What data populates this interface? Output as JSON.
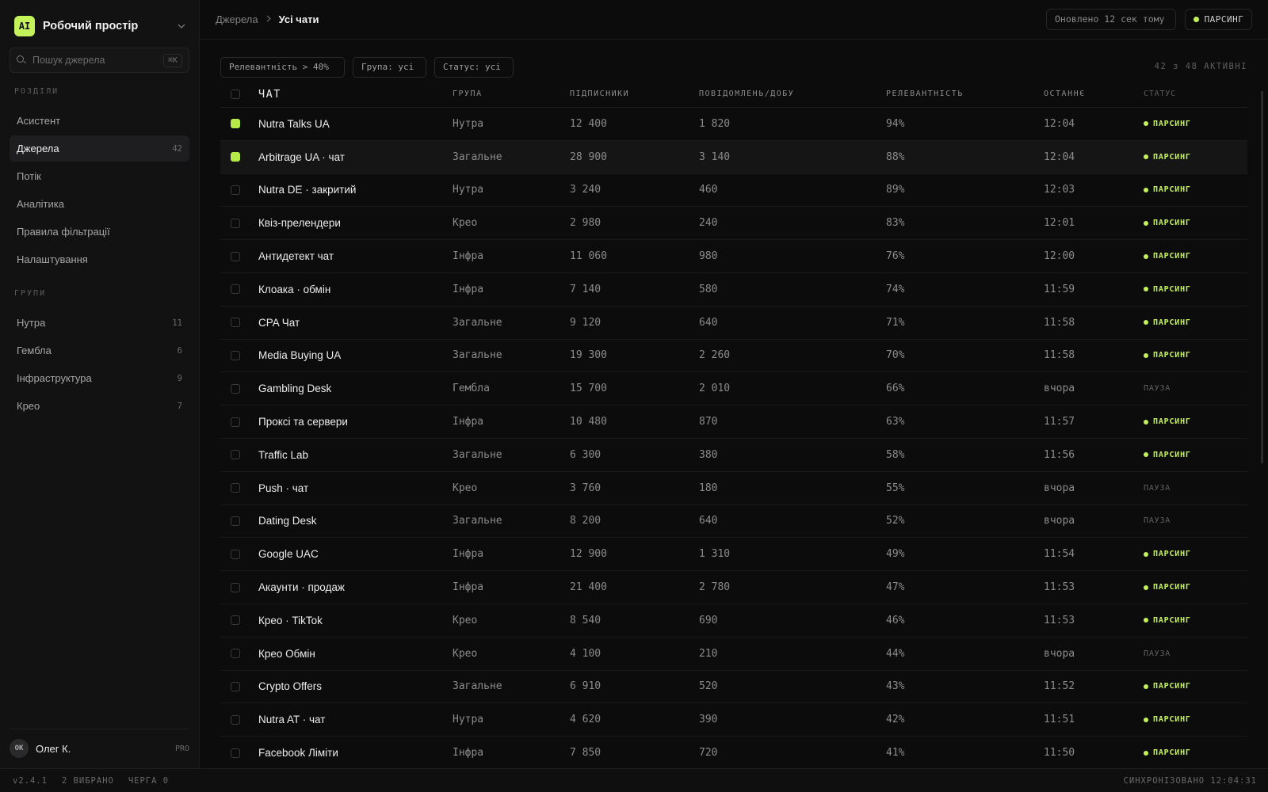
{
  "workspace": {
    "logo": "AI",
    "name": "Робочий простір"
  },
  "search": {
    "placeholder": "Пошук джерела",
    "shortcut": "⌘K"
  },
  "sections_label": "РОЗДІЛИ",
  "nav": [
    {
      "label": "Асистент",
      "count": ""
    },
    {
      "label": "Джерела",
      "count": "42"
    },
    {
      "label": "Потік",
      "count": ""
    },
    {
      "label": "Аналітика",
      "count": ""
    },
    {
      "label": "Правила фільтрації",
      "count": ""
    },
    {
      "label": "Налаштування",
      "count": ""
    }
  ],
  "groups_label": "ГРУПИ",
  "groups": [
    {
      "label": "Нутра",
      "count": "11"
    },
    {
      "label": "Гембла",
      "count": "6"
    },
    {
      "label": "Інфраструктура",
      "count": "9"
    },
    {
      "label": "Крео",
      "count": "7"
    }
  ],
  "user": {
    "initials": "OK",
    "name": "Олег К.",
    "plan": "PRO"
  },
  "breadcrumb": {
    "parent": "Джерела",
    "current": "Усі чати"
  },
  "topbar": {
    "updated": "Оновлено 12 сек тому",
    "parse_label": "ПАРСИНГ"
  },
  "filters": {
    "relevance": "Релевантність > 40%",
    "group": "Група: усі",
    "status": "Статус: усі",
    "active_count": "42 з 48 АКТИВНІ"
  },
  "table": {
    "columns": [
      "ЧАТ",
      "ГРУПА",
      "ПІДПИСНИКИ",
      "ПОВІДОМЛЕНЬ/ДОБУ",
      "РЕЛЕВАНТНІСТЬ",
      "ОСТАННЄ",
      "СТАТУС"
    ],
    "rows": [
      {
        "name": "Nutra Talks UA",
        "group": "Нутра",
        "subs": "12 400",
        "msgs": "1 820",
        "rel": "94%",
        "last": "12:04",
        "status": "ПАРСИНГ",
        "checked": true
      },
      {
        "name": "Arbitrage UA · чат",
        "group": "Загальне",
        "subs": "28 900",
        "msgs": "3 140",
        "rel": "88%",
        "last": "12:04",
        "status": "ПАРСИНГ",
        "checked": true
      },
      {
        "name": "Nutra DE · закритий",
        "group": "Нутра",
        "subs": "3 240",
        "msgs": "460",
        "rel": "89%",
        "last": "12:03",
        "status": "ПАРСИНГ",
        "checked": false
      },
      {
        "name": "Квіз-преленд­ери",
        "group": "Крео",
        "subs": "2 980",
        "msgs": "240",
        "rel": "83%",
        "last": "12:01",
        "status": "ПАРСИНГ",
        "checked": false
      },
      {
        "name": "Антидетект чат",
        "group": "Інфра",
        "subs": "11 060",
        "msgs": "980",
        "rel": "76%",
        "last": "12:00",
        "status": "ПАРСИНГ",
        "checked": false
      },
      {
        "name": "Клоака · обмін",
        "group": "Інфра",
        "subs": "7 140",
        "msgs": "580",
        "rel": "74%",
        "last": "11:59",
        "status": "ПАРСИНГ",
        "checked": false
      },
      {
        "name": "CPA Чат",
        "group": "Загальне",
        "subs": "9 120",
        "msgs": "640",
        "rel": "71%",
        "last": "11:58",
        "status": "ПАРСИНГ",
        "checked": false
      },
      {
        "name": "Media Buying UA",
        "group": "Загальне",
        "subs": "19 300",
        "msgs": "2 260",
        "rel": "70%",
        "last": "11:58",
        "status": "ПАРСИНГ",
        "checked": false
      },
      {
        "name": "Gambling Desk",
        "group": "Гембла",
        "subs": "15 700",
        "msgs": "2 010",
        "rel": "66%",
        "last": "вчора",
        "status": "ПАУЗА",
        "checked": false
      },
      {
        "name": "Проксі та сервери",
        "group": "Інфра",
        "subs": "10 480",
        "msgs": "870",
        "rel": "63%",
        "last": "11:57",
        "status": "ПАРСИНГ",
        "checked": false
      },
      {
        "name": "Traffic Lab",
        "group": "Загальне",
        "subs": "6 300",
        "msgs": "380",
        "rel": "58%",
        "last": "11:56",
        "status": "ПАРСИНГ",
        "checked": false
      },
      {
        "name": "Push · чат",
        "group": "Крео",
        "subs": "3 760",
        "msgs": "180",
        "rel": "55%",
        "last": "вчора",
        "status": "ПАУЗА",
        "checked": false
      },
      {
        "name": "Dating Desk",
        "group": "Загальне",
        "subs": "8 200",
        "msgs": "640",
        "rel": "52%",
        "last": "вчора",
        "status": "ПАУЗА",
        "checked": false
      },
      {
        "name": "Google UAC",
        "group": "Інфра",
        "subs": "12 900",
        "msgs": "1 310",
        "rel": "49%",
        "last": "11:54",
        "status": "ПАРСИНГ",
        "checked": false
      },
      {
        "name": "Акаунти · продаж",
        "group": "Інфра",
        "subs": "21 400",
        "msgs": "2 780",
        "rel": "47%",
        "last": "11:53",
        "status": "ПАРСИНГ",
        "checked": false
      },
      {
        "name": "Крео · TikTok",
        "group": "Крео",
        "subs": "8 540",
        "msgs": "690",
        "rel": "46%",
        "last": "11:53",
        "status": "ПАРСИНГ",
        "checked": false
      },
      {
        "name": "Крео Обмін",
        "group": "Крео",
        "subs": "4 100",
        "msgs": "210",
        "rel": "44%",
        "last": "вчора",
        "status": "ПАУЗА",
        "checked": false
      },
      {
        "name": "Crypto Offers",
        "group": "Загальне",
        "subs": "6 910",
        "msgs": "520",
        "rel": "43%",
        "last": "11:52",
        "status": "ПАРСИНГ",
        "checked": false
      },
      {
        "name": "Nutra AT · чат",
        "group": "Нутра",
        "subs": "4 620",
        "msgs": "390",
        "rel": "42%",
        "last": "11:51",
        "status": "ПАРСИНГ",
        "checked": false
      },
      {
        "name": "Facebook Ліміти",
        "group": "Інфра",
        "subs": "7 850",
        "msgs": "720",
        "rel": "41%",
        "last": "11:50",
        "status": "ПАРСИНГ",
        "checked": false
      }
    ]
  },
  "footer": {
    "version": "v2.4.1",
    "selected": "2 ВИБРАНО",
    "queue": "ЧЕРГА 0",
    "synced": "СИНХРОНІЗОВАНО 12:04:31"
  },
  "colors": {
    "accent": "#c4f25b",
    "background": "#0c0c0d",
    "sidebar": "#121213"
  }
}
